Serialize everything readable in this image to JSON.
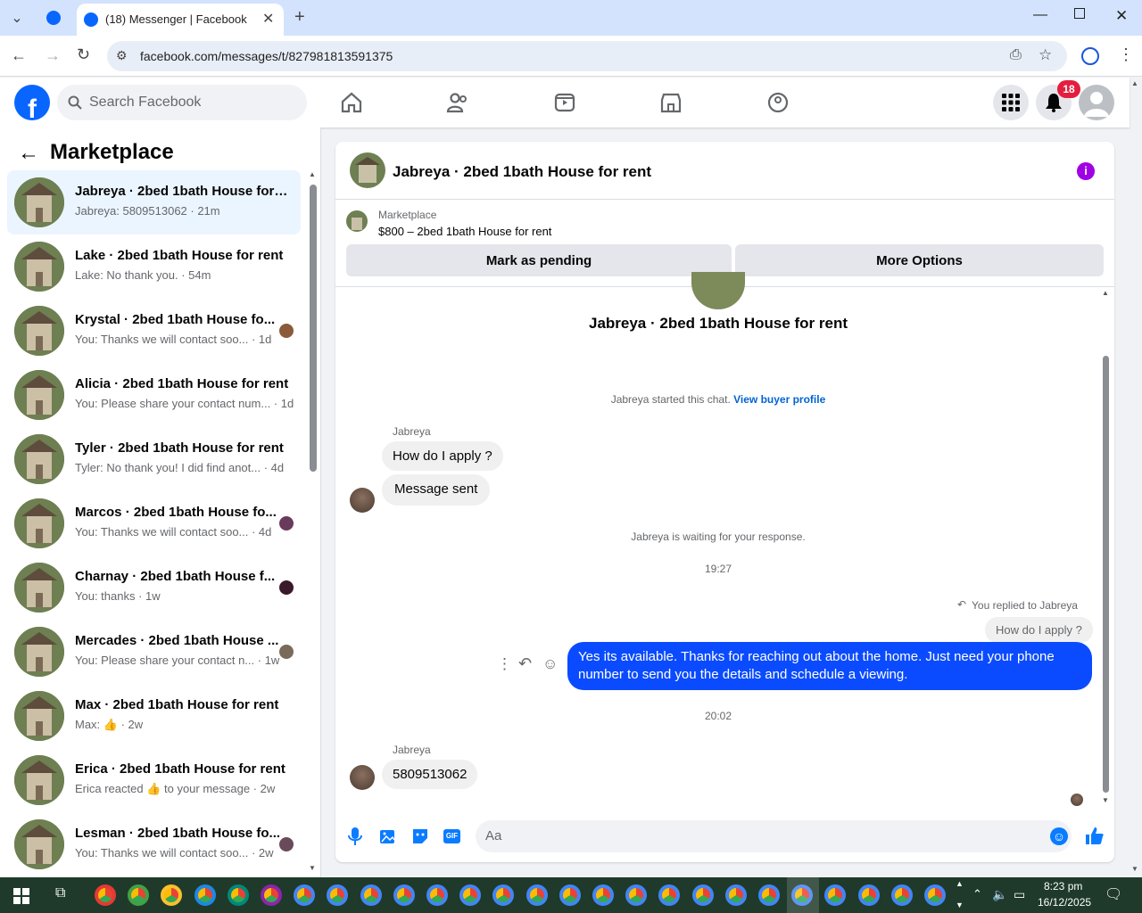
{
  "browser": {
    "tab_title": "(18) Messenger | Facebook",
    "url": "facebook.com/messages/t/827981813591375"
  },
  "fb": {
    "logo": "f",
    "search_placeholder": "Search Facebook",
    "notif_count": "18"
  },
  "sidebar": {
    "title": "Marketplace",
    "conversations": [
      {
        "title": "Jabreya · 2bed 1bath House for r...",
        "snippet": "Jabreya: 5809513062 · 21m"
      },
      {
        "title": "Lake · 2bed 1bath House for rent",
        "snippet": "Lake: No thank you. · 54m"
      },
      {
        "title": "Krystal · 2bed 1bath House fo...",
        "snippet": "You: Thanks we will contact soo... · 1d"
      },
      {
        "title": "Alicia · 2bed 1bath House for rent",
        "snippet": "You: Please share your contact num... · 1d"
      },
      {
        "title": "Tyler · 2bed 1bath House for rent",
        "snippet": "Tyler: No thank you! I did find anot... · 4d"
      },
      {
        "title": "Marcos · 2bed 1bath House fo...",
        "snippet": "You: Thanks we will contact soo... · 4d"
      },
      {
        "title": "Charnay · 2bed 1bath House f...",
        "snippet": "You: thanks · 1w"
      },
      {
        "title": "Mercades · 2bed 1bath House ...",
        "snippet": "You: Please share your contact n... · 1w"
      },
      {
        "title": "Max · 2bed 1bath House for rent",
        "snippet": "Max: 👍 · 2w"
      },
      {
        "title": "Erica · 2bed 1bath House for rent",
        "snippet": "Erica reacted 👍 to your message · 2w"
      },
      {
        "title": "Lesman · 2bed 1bath House fo...",
        "snippet": "You: Thanks we will contact soo... · 2w"
      }
    ]
  },
  "chat": {
    "header_title": "Jabreya · 2bed 1bath House for rent",
    "listing_label": "Marketplace",
    "listing_price": "$800 – 2bed 1bath House for rent",
    "mark_pending": "Mark as pending",
    "more_options": "More Options",
    "profile_name": "Jabreya · 2bed 1bath House for rent",
    "started_text": "Jabreya started this chat.",
    "view_profile": "View buyer profile",
    "sender1": "Jabreya",
    "msg1": "How do I apply ?",
    "msg2": "Message sent",
    "waiting": "Jabreya is waiting for your response.",
    "time1": "19:27",
    "replied_to": "You replied to Jabreya",
    "quoted": "How do I apply ?",
    "my_msg": "Yes its available. Thanks for reaching out about the home. Just need your phone number to send you the details and schedule a viewing.",
    "time2": "20:02",
    "sender2": "Jabreya",
    "msg3": "5809513062",
    "composer_placeholder": "Aa"
  },
  "taskbar": {
    "time": "8:23 pm",
    "date": "16/12/2025"
  }
}
